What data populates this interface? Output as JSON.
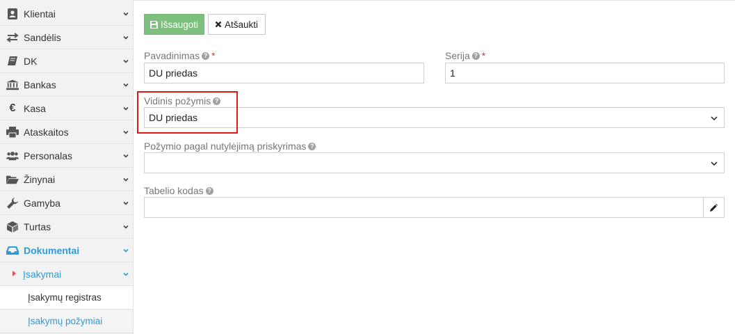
{
  "sidebar": {
    "items": [
      {
        "label": "Klientai",
        "icon": "client-icon"
      },
      {
        "label": "Sandėlis",
        "icon": "exchange-icon"
      },
      {
        "label": "DK",
        "icon": "book-icon"
      },
      {
        "label": "Bankas",
        "icon": "bank-icon"
      },
      {
        "label": "Kasa",
        "icon": "euro-icon"
      },
      {
        "label": "Ataskaitos",
        "icon": "print-icon"
      },
      {
        "label": "Personalas",
        "icon": "users-icon"
      },
      {
        "label": "Žinynai",
        "icon": "folder-icon"
      },
      {
        "label": "Gamyba",
        "icon": "wrench-icon"
      },
      {
        "label": "Turtas",
        "icon": "cube-icon"
      },
      {
        "label": "Dokumentai",
        "icon": "inbox-icon"
      }
    ],
    "submenu": {
      "label": "Įsakymai"
    },
    "subitems": [
      {
        "label": "Įsakymų registras"
      },
      {
        "label": "Įsakymų požymiai"
      }
    ]
  },
  "toolbar": {
    "save_label": "Išsaugoti",
    "cancel_label": "Atšaukti"
  },
  "form": {
    "name_label": "Pavadinimas",
    "name_value": "DU priedas",
    "series_label": "Serija",
    "series_value": "1",
    "internal_label": "Vidinis požymis",
    "internal_value": "DU priedas",
    "default_label": "Požymio pagal nutylėjimą priskyrimas",
    "default_value": "",
    "code_label": "Tabelio kodas",
    "code_value": "",
    "required_mark": "*",
    "help_mark": "?"
  },
  "colors": {
    "accent": "#2e9bd6",
    "save": "#7dbf7d",
    "required": "#e03030",
    "highlight": "#e01818"
  }
}
